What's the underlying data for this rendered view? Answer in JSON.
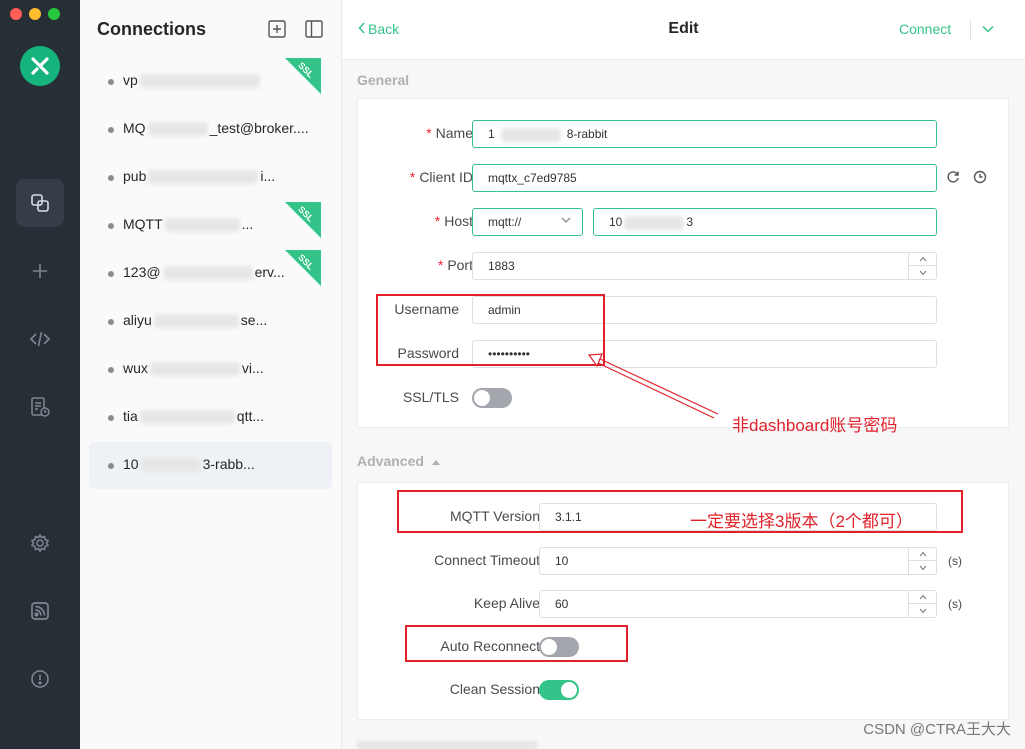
{
  "sidebar": {
    "icons": [
      "connections-icon",
      "new-connection-icon",
      "script-icon",
      "log-icon",
      "settings-icon",
      "subscribe-icon",
      "about-icon"
    ]
  },
  "connections": {
    "title": "Connections",
    "items": [
      {
        "prefix": "vp",
        "suffix": "",
        "ssl": true
      },
      {
        "prefix": "MQ",
        "suffix": "_test@broker....",
        "ssl": false
      },
      {
        "prefix": "pub",
        "suffix": "i...",
        "ssl": false
      },
      {
        "prefix": "MQTT",
        "suffix": "...",
        "ssl": true
      },
      {
        "prefix": "123@",
        "suffix": "erv...",
        "ssl": true
      },
      {
        "prefix": "aliyu",
        "suffix": "se...",
        "ssl": false
      },
      {
        "prefix": "wux",
        "suffix": "vi...",
        "ssl": false
      },
      {
        "prefix": "tia",
        "suffix": "qtt...",
        "ssl": false
      },
      {
        "prefix": "10",
        "suffix": "3-rabb...",
        "ssl": false
      }
    ],
    "ssl_label": "SSL"
  },
  "topbar": {
    "back_label": "Back",
    "title": "Edit",
    "connect_label": "Connect"
  },
  "general": {
    "section_label": "General",
    "name_label": "Name",
    "name_prefix": "1",
    "name_suffix": "8-rabbit",
    "client_id_label": "Client ID",
    "client_id_value": "mqttx_c7ed9785",
    "host_label": "Host",
    "host_protocol": "mqtt://",
    "host_prefix": "10",
    "host_suffix": "3",
    "port_label": "Port",
    "port_value": "1883",
    "username_label": "Username",
    "username_value": "admin",
    "password_label": "Password",
    "password_value": "••••••••••",
    "ssl_label": "SSL/TLS",
    "ssl_enabled": false,
    "required_mark": "*"
  },
  "advanced": {
    "section_label": "Advanced",
    "mqtt_version_label": "MQTT Version",
    "mqtt_version_value": "3.1.1",
    "connect_timeout_label": "Connect Timeout",
    "connect_timeout_value": "10",
    "keep_alive_label": "Keep Alive",
    "keep_alive_value": "60",
    "unit_label": "(s)",
    "auto_reconnect_label": "Auto Reconnect",
    "auto_reconnect_enabled": false,
    "clean_session_label": "Clean Session",
    "clean_session_enabled": true
  },
  "annotations": {
    "credentials_note": "非dashboard账号密码",
    "version_note": "一定要选择3版本（2个都可）",
    "watermark": "CSDN @CTRA王大大"
  },
  "colors": {
    "accent": "#34c388",
    "rail": "#262e36",
    "annotation": "#e0212b"
  }
}
